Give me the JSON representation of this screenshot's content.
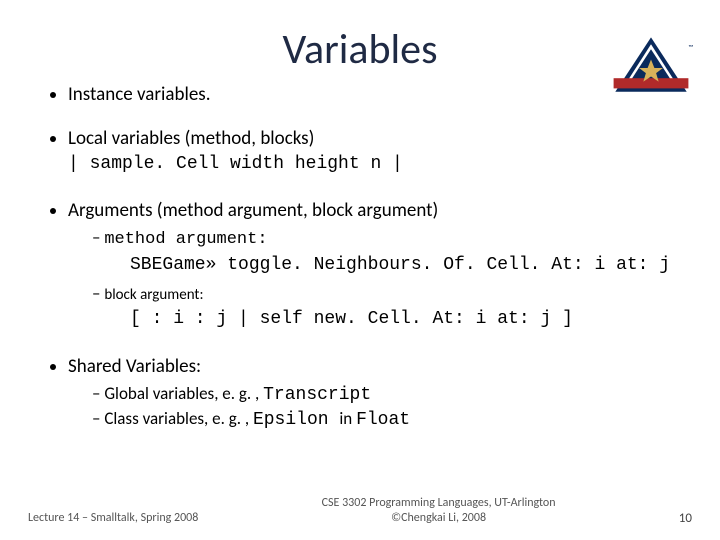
{
  "title": "Variables",
  "bullets": {
    "b1": "Instance variables.",
    "b2": "Local variables (method, blocks)",
    "b2_code": "| sample. Cell width height n |",
    "b3": "Arguments (method argument, block argument)",
    "b3_s1": "method argument:",
    "b3_code1": "SBEGame» toggle. Neighbours. Of. Cell. At: i at: j",
    "b3_s2": "block argument:",
    "b3_code2": "[ : i : j | self new. Cell. At: i at: j ]",
    "b4": "Shared Variables:",
    "b4_s1_a": "Global variables, e. g. , ",
    "b4_s1_b": "Transcript",
    "b4_s2_a": "Class variables, e. g. , ",
    "b4_s2_b": "Epsilon ",
    "b4_s2_c": "in ",
    "b4_s2_d": "Float"
  },
  "footer": {
    "left": "Lecture 14 – Smalltalk, Spring 2008",
    "center1": "CSE 3302 Programming Languages, UT-Arlington",
    "center2": "©Chengkai Li, 2008",
    "page": "10"
  },
  "logo": {
    "letter": "A",
    "star_fill": "#d8b25a",
    "banner": "#b02a2a",
    "blue": "#0a2a5c"
  }
}
